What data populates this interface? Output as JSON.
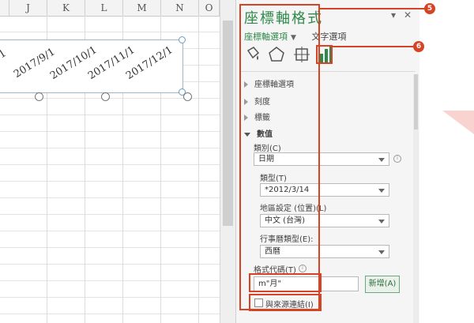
{
  "sheet": {
    "columns": [
      "J",
      "K",
      "L",
      "M",
      "N",
      "O"
    ],
    "axis_labels": [
      "6/1",
      "2017/9/1",
      "2017/10/1",
      "2017/11/1",
      "2017/12/1"
    ]
  },
  "pane": {
    "title": "座標軸格式",
    "tabs": [
      "座標軸選項",
      "文字選項"
    ],
    "sections": {
      "axis_options": "座標軸選項",
      "tick_marks": "刻度",
      "labels": "標籤",
      "number": "數值"
    },
    "category_label": "類別(C)",
    "category_value": "日期",
    "type_label": "類型(T)",
    "type_value": "*2012/3/14",
    "locale_label": "地區設定 (位置)(L)",
    "locale_value": "中文 (台灣)",
    "calendar_label": "行事曆類型(E):",
    "calendar_value": "西曆",
    "format_code_label": "格式代碼(T)",
    "format_code_value": "m\"月\"",
    "add_button": "新增(A)",
    "link_source_label": "與來源連結(I)"
  },
  "annotations": {
    "badge_a": "5",
    "badge_b": "6"
  },
  "colors": {
    "accent_green": "#2f8a4a",
    "annotation_red": "#d64426"
  }
}
